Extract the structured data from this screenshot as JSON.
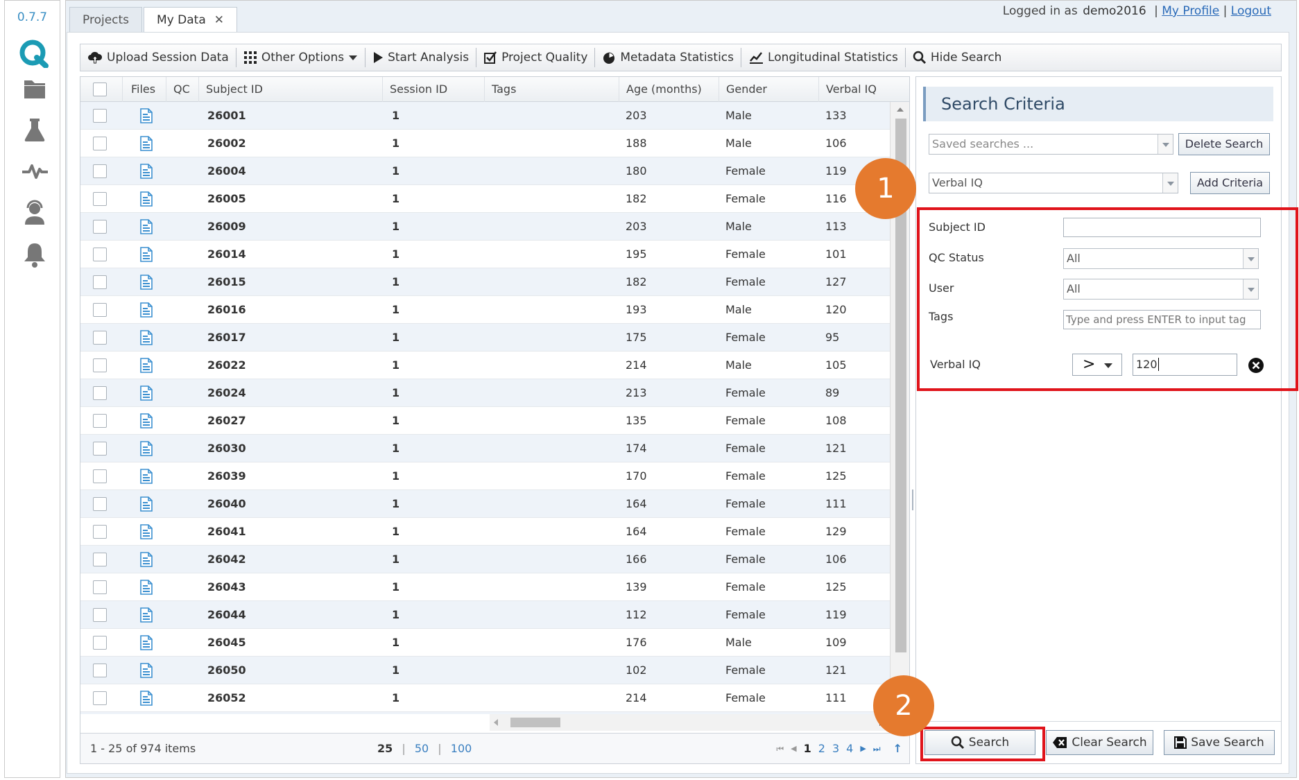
{
  "version": "0.7.7",
  "colors": {
    "accent": "#1b9bb4",
    "badge": "#e57a2e",
    "highlight": "#e0141b",
    "link": "#2a6ab8"
  },
  "nav_icons": [
    "folder-icon",
    "flask-icon",
    "pulse-icon",
    "support-agent-icon",
    "bell-icon"
  ],
  "tabs": [
    {
      "label": "Projects"
    },
    {
      "label": "My Data",
      "close": "✕"
    }
  ],
  "header": {
    "logged_in_prefix": "Logged in as",
    "username": "demo2016",
    "my_profile": "My Profile",
    "logout": "Logout",
    "sep": "|"
  },
  "toolbar": {
    "upload": "Upload Session Data",
    "other": "Other Options",
    "start": "Start Analysis",
    "quality": "Project Quality",
    "metadata": "Metadata Statistics",
    "longitudinal": "Longitudinal Statistics",
    "hide": "Hide Search"
  },
  "grid": {
    "columns": {
      "files": "Files",
      "qc": "QC",
      "subject": "Subject ID",
      "session": "Session ID",
      "tags": "Tags",
      "age": "Age (months)",
      "gender": "Gender",
      "viq": "Verbal IQ"
    },
    "rows": [
      {
        "subject": "26001",
        "session": "1",
        "age": "203",
        "gender": "Male",
        "viq": "133"
      },
      {
        "subject": "26002",
        "session": "1",
        "age": "188",
        "gender": "Male",
        "viq": "106"
      },
      {
        "subject": "26004",
        "session": "1",
        "age": "180",
        "gender": "Female",
        "viq": "119"
      },
      {
        "subject": "26005",
        "session": "1",
        "age": "182",
        "gender": "Female",
        "viq": "116"
      },
      {
        "subject": "26009",
        "session": "1",
        "age": "203",
        "gender": "Male",
        "viq": "113"
      },
      {
        "subject": "26014",
        "session": "1",
        "age": "195",
        "gender": "Female",
        "viq": "101"
      },
      {
        "subject": "26015",
        "session": "1",
        "age": "182",
        "gender": "Female",
        "viq": "127"
      },
      {
        "subject": "26016",
        "session": "1",
        "age": "193",
        "gender": "Male",
        "viq": "120"
      },
      {
        "subject": "26017",
        "session": "1",
        "age": "175",
        "gender": "Female",
        "viq": "95"
      },
      {
        "subject": "26022",
        "session": "1",
        "age": "214",
        "gender": "Male",
        "viq": "105"
      },
      {
        "subject": "26024",
        "session": "1",
        "age": "213",
        "gender": "Female",
        "viq": "89"
      },
      {
        "subject": "26027",
        "session": "1",
        "age": "135",
        "gender": "Female",
        "viq": "108"
      },
      {
        "subject": "26030",
        "session": "1",
        "age": "174",
        "gender": "Female",
        "viq": "121"
      },
      {
        "subject": "26039",
        "session": "1",
        "age": "170",
        "gender": "Female",
        "viq": "125"
      },
      {
        "subject": "26040",
        "session": "1",
        "age": "164",
        "gender": "Female",
        "viq": "111"
      },
      {
        "subject": "26041",
        "session": "1",
        "age": "164",
        "gender": "Female",
        "viq": "129"
      },
      {
        "subject": "26042",
        "session": "1",
        "age": "166",
        "gender": "Female",
        "viq": "106"
      },
      {
        "subject": "26043",
        "session": "1",
        "age": "139",
        "gender": "Female",
        "viq": "125"
      },
      {
        "subject": "26044",
        "session": "1",
        "age": "112",
        "gender": "Female",
        "viq": "119"
      },
      {
        "subject": "26045",
        "session": "1",
        "age": "176",
        "gender": "Male",
        "viq": "109"
      },
      {
        "subject": "26050",
        "session": "1",
        "age": "102",
        "gender": "Female",
        "viq": "121"
      },
      {
        "subject": "26052",
        "session": "1",
        "age": "214",
        "gender": "Female",
        "viq": "111"
      }
    ]
  },
  "pager": {
    "info": "1 - 25 of 974 items",
    "sizes": [
      "25",
      "50",
      "100"
    ],
    "pages": [
      "1",
      "2",
      "3",
      "4"
    ],
    "first": "⏮",
    "prev": "◀",
    "next": "▶",
    "last": "⏭",
    "top": "↑"
  },
  "search": {
    "title": "Search Criteria",
    "saved_placeholder": "Saved searches ...",
    "delete": "Delete Search",
    "criteria_value": "Verbal IQ",
    "add_criteria": "Add Criteria",
    "fields": {
      "subject_label": "Subject ID",
      "qc_label": "QC Status",
      "qc_value": "All",
      "user_label": "User",
      "user_value": "All",
      "tags_label": "Tags",
      "tags_placeholder": "Type and press ENTER to input tag",
      "viq_label": "Verbal IQ",
      "viq_operator": ">",
      "viq_value": "120"
    },
    "search_btn": "Search",
    "clear_btn": "Clear Search",
    "save_btn": "Save Search"
  },
  "badges": {
    "one": "1",
    "two": "2"
  }
}
